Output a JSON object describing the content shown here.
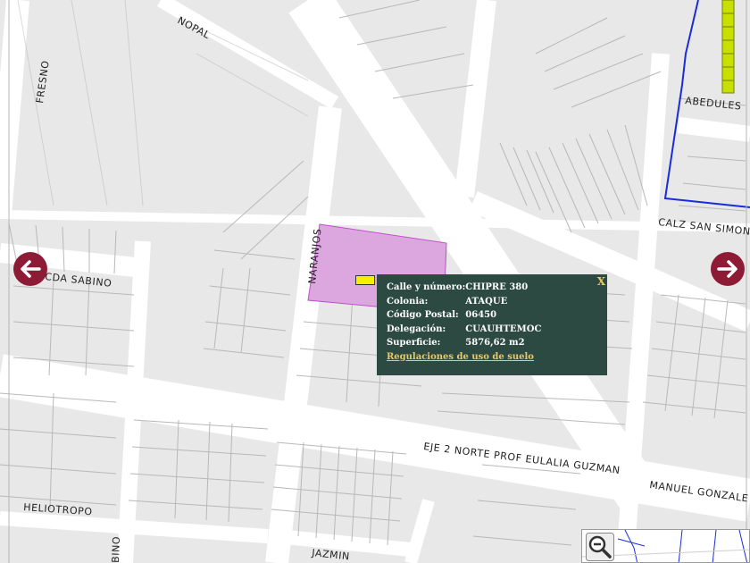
{
  "map": {
    "streets": [
      {
        "id": "nopal",
        "label": "NOPAL"
      },
      {
        "id": "fresno",
        "label": "FRESNO"
      },
      {
        "id": "abedules",
        "label": "ABEDULES"
      },
      {
        "id": "calz-san-simon",
        "label": "CALZ SAN SIMON"
      },
      {
        "id": "naranjos",
        "label": "NARANJOS"
      },
      {
        "id": "cda-sabino",
        "label": "CDA SABINO"
      },
      {
        "id": "eje2",
        "label": "EJE 2 NORTE PROF EULALIA GUZMAN"
      },
      {
        "id": "manuel-gonzalez",
        "label": "MANUEL GONZALE"
      },
      {
        "id": "heliotropo",
        "label": "HELIOTROPO"
      },
      {
        "id": "jazmin",
        "label": "JAZMIN"
      },
      {
        "id": "sabino",
        "label": "BINO"
      }
    ],
    "colors": {
      "block": "#e8e8e8",
      "road": "#ffffff",
      "parcel_line": "#b8b8b8",
      "selected_parcel": "#dca6df",
      "selected_parcel_border": "#c24ec9",
      "boundary": "#1a2cd8",
      "rail": "#c8e000",
      "nav_arrow": "#8e1b36",
      "popup_bg": "#2c4a41",
      "popup_link": "#e8c869"
    }
  },
  "popup": {
    "close_label": "X",
    "rows": [
      {
        "label": "Calle y número:",
        "value": "CHIPRE 380"
      },
      {
        "label": "Colonia:",
        "value": "ATAQUE"
      },
      {
        "label": "Código Postal:",
        "value": "06450"
      },
      {
        "label": "Delegación:",
        "value": "CUAUHTEMOC"
      },
      {
        "label": "Superficie:",
        "value": "5876,62 m2"
      }
    ],
    "link_label": "Regulaciones de uso de suelo"
  },
  "controls": {
    "prev_icon": "arrow-left-icon",
    "next_icon": "arrow-right-icon",
    "zoom_icon": "zoom-out-icon"
  }
}
